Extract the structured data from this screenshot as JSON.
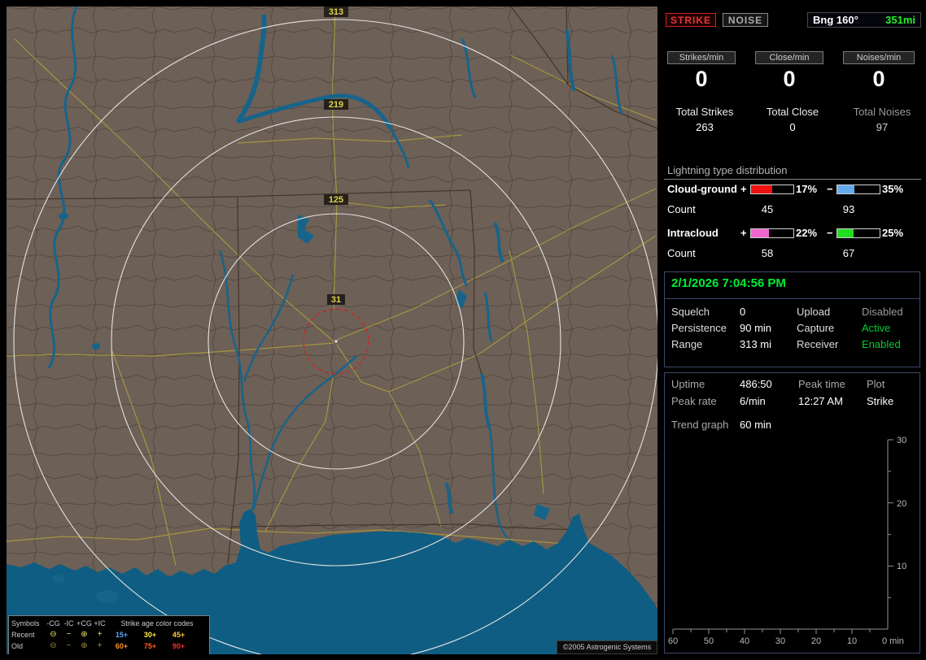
{
  "map": {
    "ring_labels": [
      "313",
      "219",
      "125",
      "31"
    ],
    "copyright": "©2005 Astrogenic Systems",
    "legend": {
      "header": "Symbols",
      "columns": [
        "-CG",
        "-IC",
        "+CG",
        "+IC"
      ],
      "age_header": "Strike age color codes",
      "rows": [
        {
          "label": "Recent",
          "symbols": [
            "⊖",
            "−",
            "⊕",
            "+"
          ],
          "symbol_color": "#e8e06a",
          "ages": [
            {
              "text": "15+",
              "color": "#57a8ff"
            },
            {
              "text": "30+",
              "color": "#ffe84a"
            },
            {
              "text": "45+",
              "color": "#ffc83c"
            }
          ]
        },
        {
          "label": "Old",
          "symbols": [
            "⊖",
            "−",
            "⊕",
            "+"
          ],
          "symbol_color": "#a08c3a",
          "ages": [
            {
              "text": "60+",
              "color": "#ff9632"
            },
            {
              "text": "75+",
              "color": "#ff6426"
            },
            {
              "text": "90+",
              "color": "#ff2a2a"
            }
          ]
        }
      ]
    }
  },
  "panel": {
    "strike_label": "STRIKE",
    "noise_label": "NOISE",
    "bearing_label": "Bng 160°",
    "bearing_range": "351mi",
    "rate_counters": [
      {
        "label": "Strikes/min",
        "value": "0"
      },
      {
        "label": "Close/min",
        "value": "0"
      },
      {
        "label": "Noises/min",
        "value": "0"
      }
    ],
    "totals": [
      {
        "label": "Total Strikes",
        "value": "263"
      },
      {
        "label": "Total Close",
        "value": "0"
      },
      {
        "label": "Total Noises",
        "value": "97"
      }
    ],
    "distribution": {
      "title": "Lightning type distribution",
      "plus": "+",
      "minus": "−",
      "rows": [
        {
          "label": "Cloud-ground",
          "pos_pct": "17%",
          "neg_pct": "35%",
          "pos_color": "#ee1111",
          "neg_color": "#66aaee",
          "pos_fill": 50,
          "neg_fill": 40,
          "count_label": "Count",
          "pos_count": "45",
          "neg_count": "93"
        },
        {
          "label": "Intracloud",
          "pos_pct": "22%",
          "neg_pct": "25%",
          "pos_color": "#ee66cc",
          "neg_color": "#22dd22",
          "pos_fill": 42,
          "neg_fill": 38,
          "count_label": "Count",
          "pos_count": "58",
          "neg_count": "67"
        }
      ]
    },
    "status": {
      "datetime": "2/1/2026 7:04:56 PM",
      "rows": [
        {
          "l1": "Squelch",
          "v1": "0",
          "l2": "Upload",
          "v2": "Disabled",
          "v2_color": "#9a9a9a"
        },
        {
          "l1": "Persistence",
          "v1": "90 min",
          "l2": "Capture",
          "v2": "Active",
          "v2_color": "#00cc33"
        },
        {
          "l1": "Range",
          "v1": "313 mi",
          "l2": "Receiver",
          "v2": "Enabled",
          "v2_color": "#00cc33"
        }
      ]
    },
    "stats": {
      "uptime_label": "Uptime",
      "uptime": "486:50",
      "peaktime_label": "Peak time",
      "plot_label": "Plot",
      "peakrate_label": "Peak rate",
      "peakrate": "6/min",
      "peaktime": "12:27 AM",
      "plot_value": "Strike",
      "trend_label": "Trend graph",
      "trend_window": "60 min"
    },
    "chart": {
      "type": "line",
      "title": "Strike trend graph (no data plotted)",
      "x_ticks": [
        "60",
        "50",
        "40",
        "30",
        "20",
        "10"
      ],
      "y_ticks": [
        "30",
        "20",
        "10"
      ],
      "origin_label": "0 min",
      "series": []
    }
  }
}
